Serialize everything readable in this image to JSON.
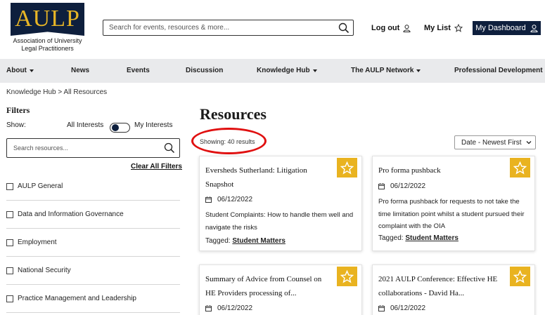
{
  "header": {
    "logo_text": "AULP",
    "logo_subtitle": "Association of University Legal Practitioners",
    "search_placeholder": "Search for events, resources & more...",
    "logout_label": "Log out",
    "mylist_label": "My List",
    "dashboard_label": "My Dashboard"
  },
  "nav": {
    "items": [
      {
        "label": "About",
        "dropdown": true
      },
      {
        "label": "News",
        "dropdown": false
      },
      {
        "label": "Events",
        "dropdown": false
      },
      {
        "label": "Discussion",
        "dropdown": false
      },
      {
        "label": "Knowledge Hub",
        "dropdown": true
      },
      {
        "label": "The AULP Network",
        "dropdown": true
      },
      {
        "label": "Professional Development",
        "dropdown": false
      }
    ]
  },
  "breadcrumb": {
    "parent": "Knowledge Hub",
    "separator": " > ",
    "current": "All Resources"
  },
  "filters": {
    "title": "Filters",
    "show_label": "Show:",
    "all_interests": "All Interests",
    "my_interests": "My Interests",
    "search_placeholder": "Search resources...",
    "clear_all": "Clear All Filters",
    "interests": [
      "AULP General",
      "Data and Information Governance",
      "Employment",
      "National Security",
      "Practice Management and Leadership"
    ]
  },
  "results": {
    "title": "Resources",
    "showing": "Showing: 40 results",
    "sort_value": "Date - Newest First",
    "cards": [
      {
        "title": "Eversheds Sutherland: Litigation Snapshot",
        "date": "06/12/2022",
        "description": "Student Complaints: How to handle them well and navigate the risks",
        "tag_label": "Tagged:",
        "tag": "Student Matters"
      },
      {
        "title": "Pro forma pushback",
        "date": "06/12/2022",
        "description": "Pro forma pushback for requests to not take the time limitation point whilst a student pursued their complaint with the OIA",
        "tag_label": "Tagged:",
        "tag": "Student Matters"
      },
      {
        "title": "Summary of Advice from Counsel on HE Providers processing of...",
        "date": "06/12/2022"
      },
      {
        "title": "2021 AULP Conference: Effective HE collaborations - David Ha...",
        "date": "06/12/2022"
      }
    ]
  },
  "colors": {
    "brand_navy": "#0e1f3d",
    "brand_gold": "#e7b526",
    "star_gold": "#e9b320",
    "annotation_red": "#e01010",
    "nav_bg": "#e9eaec"
  }
}
